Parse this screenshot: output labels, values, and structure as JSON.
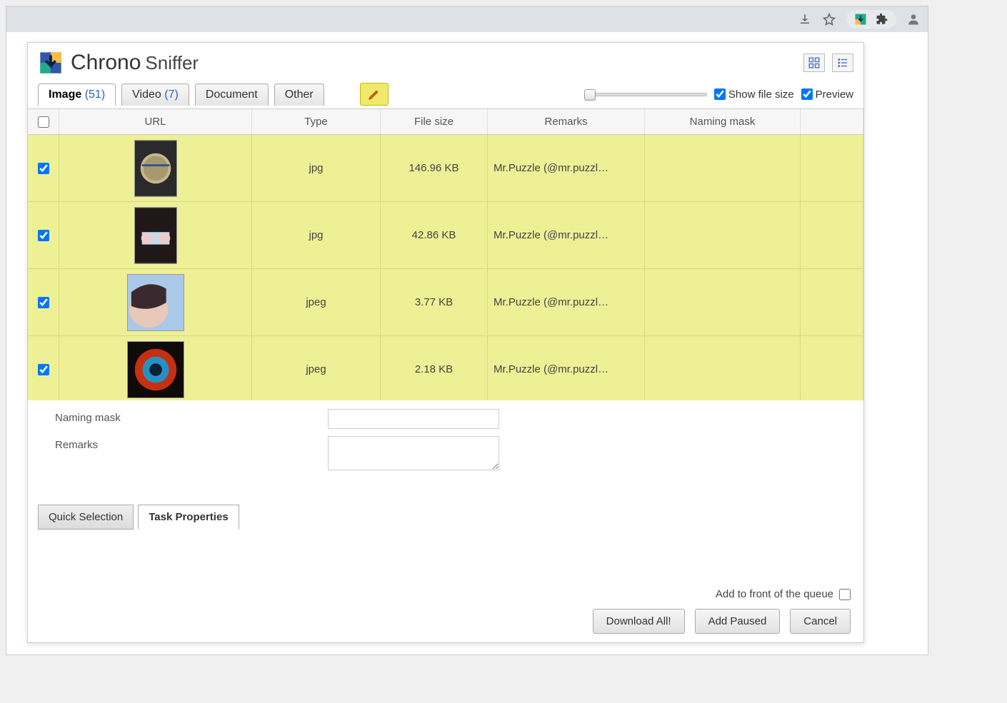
{
  "app": {
    "name_main": "Chrono",
    "name_sub": "Sniffer"
  },
  "tabs": {
    "image": {
      "label": "Image",
      "count": "(51)"
    },
    "video": {
      "label": "Video",
      "count": "(7)"
    },
    "document": {
      "label": "Document"
    },
    "other": {
      "label": "Other"
    }
  },
  "options": {
    "show_file_size": "Show file size",
    "preview": "Preview"
  },
  "columns": {
    "url": "URL",
    "type": "Type",
    "size": "File size",
    "remarks": "Remarks",
    "mask": "Naming mask"
  },
  "rows": [
    {
      "checked": true,
      "type": "jpg",
      "size": "146.96 KB",
      "remarks": "Mr.Puzzle (@mr.puzzl…",
      "mask": ""
    },
    {
      "checked": true,
      "type": "jpg",
      "size": "42.86 KB",
      "remarks": "Mr.Puzzle (@mr.puzzl…",
      "mask": ""
    },
    {
      "checked": true,
      "type": "jpeg",
      "size": "3.77 KB",
      "remarks": "Mr.Puzzle (@mr.puzzl…",
      "mask": ""
    },
    {
      "checked": true,
      "type": "jpeg",
      "size": "2.18 KB",
      "remarks": "Mr.Puzzle (@mr.puzzl…",
      "mask": ""
    }
  ],
  "props": {
    "naming_mask_label": "Naming mask",
    "remarks_label": "Remarks",
    "naming_mask_value": "",
    "remarks_value": ""
  },
  "bottom_tabs": {
    "quick": "Quick Selection",
    "task": "Task Properties"
  },
  "footer": {
    "queue_label": "Add to front of the queue",
    "download_all": "Download All!",
    "add_paused": "Add Paused",
    "cancel": "Cancel"
  }
}
